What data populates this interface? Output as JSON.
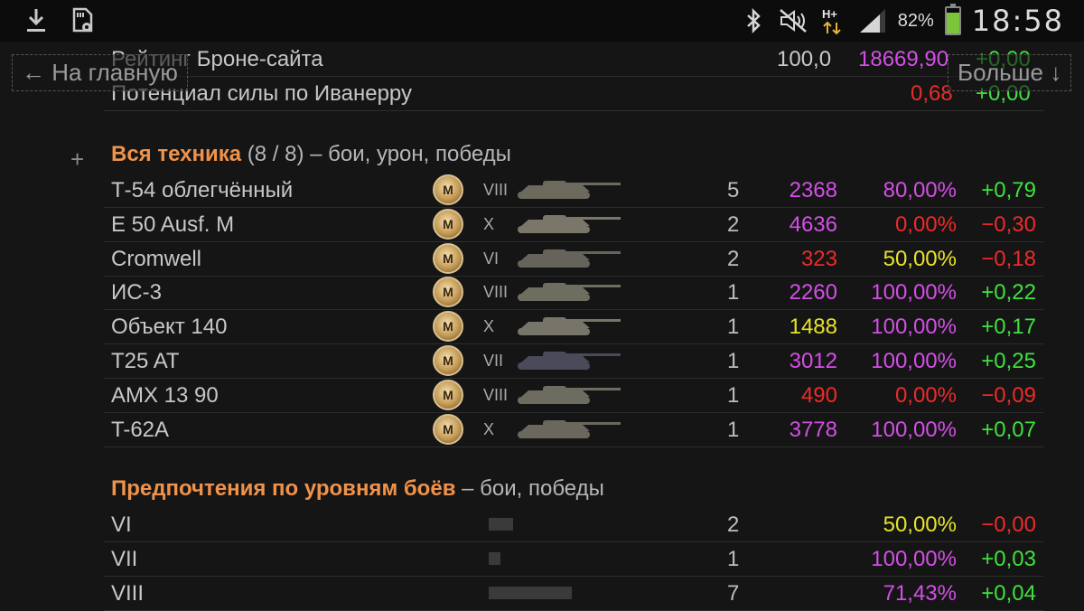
{
  "status_bar": {
    "battery_percent": 82,
    "battery_text": "82%",
    "time": "18:58",
    "network_type": "H+",
    "left_icons": [
      "download-icon",
      "sd-card-settings-icon"
    ],
    "right_icons": [
      "bluetooth-icon",
      "mute-icon",
      "mobile-data-icon",
      "signal-icon",
      "battery-icon"
    ]
  },
  "nav": {
    "home_label": "← На главную",
    "more_label": "Больше ↓"
  },
  "top_rows": [
    {
      "name": "Рейтинг Броне-сайта",
      "value": "100,0",
      "score": "18669,90",
      "delta": "+0,00"
    },
    {
      "name": "Потенциал силы по Иванерру",
      "score": "0,68",
      "delta": "+0,00"
    }
  ],
  "vehicles_section": {
    "title": "Вся техника",
    "count": "(8 / 8)",
    "suffix": "– бои, урон, победы",
    "badge_label": "M",
    "rows": [
      {
        "name": "Т-54 облегчённый",
        "tier": "VIII",
        "battles": "5",
        "damage": "2368",
        "damage_color": "purple",
        "winrate": "80,00%",
        "winrate_color": "purple",
        "delta": "+0,79",
        "delta_color": "green",
        "tank_color": "#6c6a5c"
      },
      {
        "name": "E 50 Ausf. M",
        "tier": "X",
        "battles": "2",
        "damage": "4636",
        "damage_color": "purple",
        "winrate": "0,00%",
        "winrate_color": "red",
        "delta": "−0,30",
        "delta_color": "red",
        "tank_color": "#7a776a"
      },
      {
        "name": "Cromwell",
        "tier": "VI",
        "battles": "2",
        "damage": "323",
        "damage_color": "red",
        "winrate": "50,00%",
        "winrate_color": "yellow",
        "delta": "−0,18",
        "delta_color": "red",
        "tank_color": "#66645a"
      },
      {
        "name": "ИС-3",
        "tier": "VIII",
        "battles": "1",
        "damage": "2260",
        "damage_color": "purple",
        "winrate": "100,00%",
        "winrate_color": "purple",
        "delta": "+0,22",
        "delta_color": "green",
        "tank_color": "#6f6d60"
      },
      {
        "name": "Объект 140",
        "tier": "X",
        "battles": "1",
        "damage": "1488",
        "damage_color": "yellow",
        "winrate": "100,00%",
        "winrate_color": "purple",
        "delta": "+0,17",
        "delta_color": "green",
        "tank_color": "#77756a"
      },
      {
        "name": "T25 AT",
        "tier": "VII",
        "battles": "1",
        "damage": "3012",
        "damage_color": "purple",
        "winrate": "100,00%",
        "winrate_color": "purple",
        "delta": "+0,25",
        "delta_color": "green",
        "tank_color": "#4a4a5a"
      },
      {
        "name": "AMX 13 90",
        "tier": "VIII",
        "battles": "1",
        "damage": "490",
        "damage_color": "red",
        "winrate": "0,00%",
        "winrate_color": "red",
        "delta": "−0,09",
        "delta_color": "red",
        "tank_color": "#6e6c60"
      },
      {
        "name": "T-62A",
        "tier": "X",
        "battles": "1",
        "damage": "3778",
        "damage_color": "purple",
        "winrate": "100,00%",
        "winrate_color": "purple",
        "delta": "+0,07",
        "delta_color": "green",
        "tank_color": "#6a685c"
      }
    ]
  },
  "levels_section": {
    "title": "Предпочтения по уровням боёв",
    "suffix": "– бои, победы",
    "rows": [
      {
        "level": "VI",
        "bar_share": 0.29,
        "battles": "2",
        "winrate": "50,00%",
        "winrate_color": "yellow",
        "delta": "−0,00",
        "delta_color": "red"
      },
      {
        "level": "VII",
        "bar_share": 0.14,
        "battles": "1",
        "winrate": "100,00%",
        "winrate_color": "purple",
        "delta": "+0,03",
        "delta_color": "green"
      },
      {
        "level": "VIII",
        "bar_share": 1.0,
        "battles": "7",
        "winrate": "71,43%",
        "winrate_color": "purple",
        "delta": "+0,04",
        "delta_color": "green"
      }
    ]
  }
}
